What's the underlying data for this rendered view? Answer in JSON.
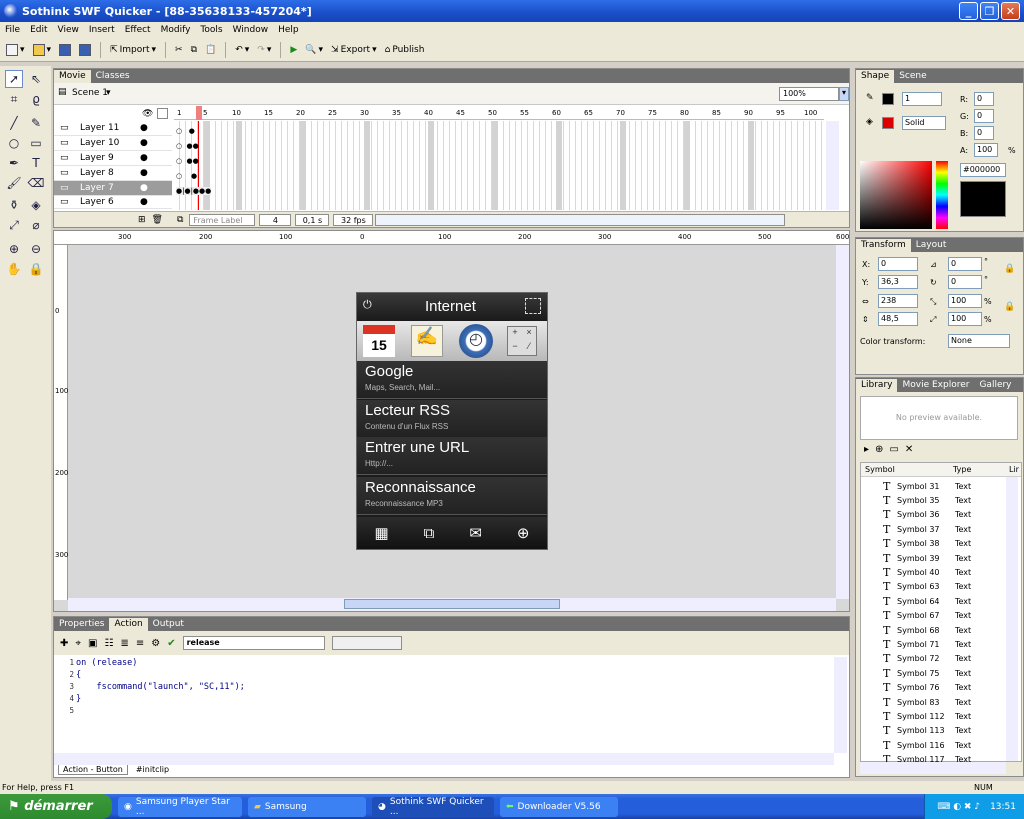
{
  "window": {
    "title": "Sothink SWF Quicker - [88-35638133-457204*]"
  },
  "menu": [
    "File",
    "Edit",
    "View",
    "Insert",
    "Effect",
    "Modify",
    "Tools",
    "Window",
    "Help"
  ],
  "toolbar": {
    "import_label": "Import",
    "export_label": "Export",
    "publish_label": "Publish"
  },
  "timeline": {
    "tabs": [
      "Movie",
      "Classes"
    ],
    "scene_label": "Scene 1",
    "zoom": "100%",
    "frame_numbers": [
      "1",
      "5",
      "10",
      "15",
      "20",
      "25",
      "30",
      "35",
      "40",
      "45",
      "50",
      "55",
      "60",
      "65",
      "70",
      "75",
      "80",
      "85",
      "90",
      "95",
      "100"
    ],
    "layers": [
      "Layer 11",
      "Layer 10",
      "Layer 9",
      "Layer 8",
      "Layer 7",
      "Layer 6"
    ],
    "selected_layer": "Layer 7",
    "frame_label_placeholder": "Frame Label",
    "current_frame": "4",
    "time": "0,1 s",
    "fps": "32 fps"
  },
  "rulers": {
    "horizontal": [
      "300",
      "200",
      "100",
      "0",
      "100",
      "200",
      "300",
      "400",
      "500",
      "600"
    ],
    "vertical": [
      "0",
      "100",
      "200",
      "300"
    ]
  },
  "phone": {
    "header": "Internet",
    "items": [
      {
        "title": "Google",
        "subtitle": "Maps, Search, Mail..."
      },
      {
        "title": "Lecteur RSS",
        "subtitle": "Contenu d'un Flux RSS"
      },
      {
        "title": "Entrer une URL",
        "subtitle": "Http://..."
      },
      {
        "title": "Reconnaissance",
        "subtitle": "Reconnaissance MP3"
      }
    ],
    "calendar_day": "15"
  },
  "action_panel": {
    "tabs": [
      "Properties",
      "Action",
      "Output"
    ],
    "event": "release",
    "line_numbers": [
      "1",
      "2",
      "3",
      "4",
      "5"
    ],
    "code": [
      "on (release)",
      "{",
      "    fscommand(\"launch\", \"SC,11\");",
      "}",
      ""
    ],
    "bottom_tabs": [
      "Action - Button",
      "#initclip"
    ]
  },
  "shape_panel": {
    "tabs": [
      "Shape",
      "Scene"
    ],
    "stroke_width": "1",
    "fill_style": "Solid",
    "r": "0",
    "g": "0",
    "b": "0",
    "a": "100",
    "hex": "#000000",
    "r_label": "R:",
    "g_label": "G:",
    "b_label": "B:",
    "a_label": "A:",
    "percent": "%"
  },
  "transform_panel": {
    "tabs": [
      "Transform",
      "Layout"
    ],
    "x_label": "X:",
    "y_label": "Y:",
    "x": "0",
    "y": "36,3",
    "w": "238",
    "h": "48,5",
    "rot1": "0",
    "rot2": "0",
    "scale_w": "100",
    "scale_h": "100",
    "deg": "°",
    "percent": "%",
    "color_transform_label": "Color transform:",
    "color_transform": "None"
  },
  "library_panel": {
    "tabs": [
      "Library",
      "Movie Explorer",
      "Gallery"
    ],
    "preview": "No preview available.",
    "col_symbol": "Symbol",
    "col_type": "Type",
    "col_link": "Lir",
    "symbols": [
      {
        "name": "Symbol 31",
        "type": "Text"
      },
      {
        "name": "Symbol 35",
        "type": "Text"
      },
      {
        "name": "Symbol 36",
        "type": "Text"
      },
      {
        "name": "Symbol 37",
        "type": "Text"
      },
      {
        "name": "Symbol 38",
        "type": "Text"
      },
      {
        "name": "Symbol 39",
        "type": "Text"
      },
      {
        "name": "Symbol 40",
        "type": "Text"
      },
      {
        "name": "Symbol 63",
        "type": "Text"
      },
      {
        "name": "Symbol 64",
        "type": "Text"
      },
      {
        "name": "Symbol 67",
        "type": "Text"
      },
      {
        "name": "Symbol 68",
        "type": "Text"
      },
      {
        "name": "Symbol 71",
        "type": "Text"
      },
      {
        "name": "Symbol 72",
        "type": "Text"
      },
      {
        "name": "Symbol 75",
        "type": "Text"
      },
      {
        "name": "Symbol 76",
        "type": "Text"
      },
      {
        "name": "Symbol 83",
        "type": "Text"
      },
      {
        "name": "Symbol 112",
        "type": "Text"
      },
      {
        "name": "Symbol 113",
        "type": "Text"
      },
      {
        "name": "Symbol 116",
        "type": "Text"
      },
      {
        "name": "Symbol 117",
        "type": "Text"
      }
    ]
  },
  "status": {
    "help": "For Help, press F1",
    "num": "NUM"
  },
  "taskbar": {
    "start": "démarrer",
    "tasks": [
      "Samsung Player Star ...",
      "Samsung",
      "Sothink SWF Quicker ...",
      "Downloader V5.56"
    ],
    "clock": "13:51"
  }
}
